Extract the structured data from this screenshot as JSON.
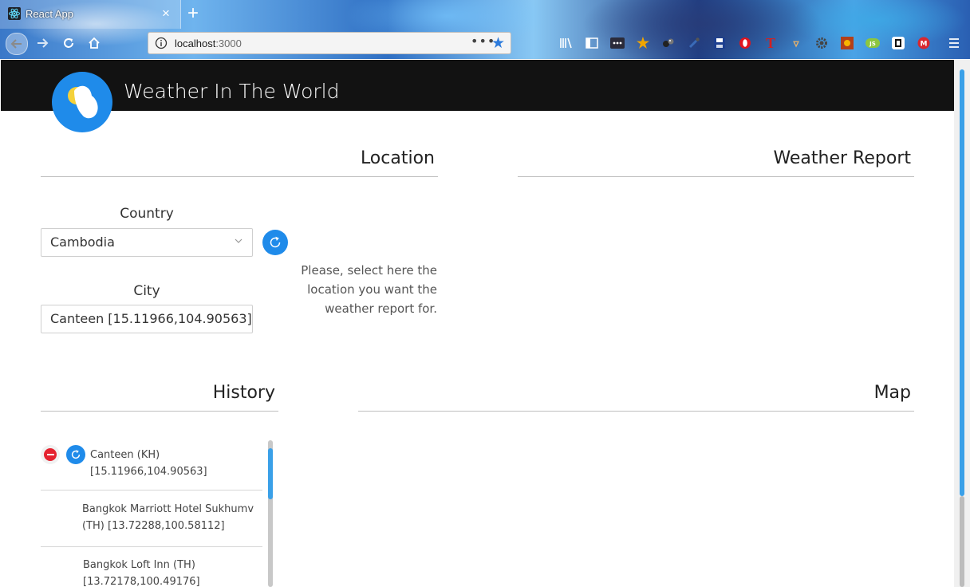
{
  "browser": {
    "tab_title": "React App",
    "tab_close": "×",
    "new_tab": "+",
    "url_host": "localhost",
    "url_port": ":3000",
    "url_more": "•••"
  },
  "app": {
    "title": "Weather In The World"
  },
  "location": {
    "title": "Location",
    "country_label": "Country",
    "country_value": "Cambodia",
    "city_label": "City",
    "city_value": "Canteen [15.11966,104.90563]",
    "hint": "Please, select here the location you want the weather report for."
  },
  "weather_report": {
    "title": "Weather Report"
  },
  "history": {
    "title": "History",
    "items": [
      {
        "line1": "Canteen (KH)",
        "line2": "[15.11966,104.90563]"
      },
      {
        "line1": "Bangkok Marriott Hotel Sukhumv",
        "line2": "(TH) [13.72288,100.58112]"
      },
      {
        "line1": "Bangkok Loft Inn (TH)",
        "line2": "[13.72178,100.49176]"
      }
    ]
  },
  "map": {
    "title": "Map"
  },
  "colors": {
    "accent": "#1f8bea",
    "header_bg": "#121212",
    "remove": "#e5222f"
  }
}
